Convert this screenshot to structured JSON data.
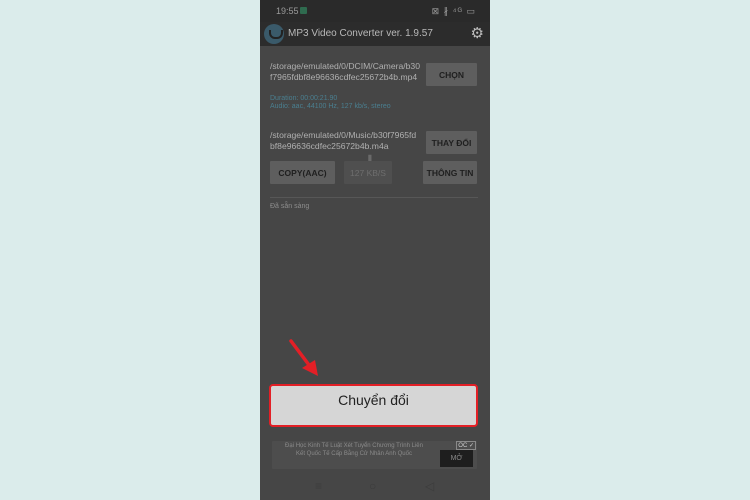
{
  "status_bar": {
    "time": "19:55",
    "right_icons": "⊠ ∦ ⁴ᴳ ▭"
  },
  "app": {
    "title": "MP3 Video Converter ver. 1.9.57"
  },
  "input": {
    "path": "/storage/emulated/0/DCIM/Camera/b30f7965fdbf8e96636cdfec25672b4b.mp4",
    "duration": "Duration: 00:00:21.90",
    "audio": "Audio: aac, 44100 Hz, 127 kb/s, stereo",
    "choose_label": "CHỌN"
  },
  "output": {
    "path": "/storage/emulated/0/Music/b30f7965fdbf8e96636cdfec25672b4b.m4a",
    "change_label": "THAY ĐỔI"
  },
  "options": {
    "codec_label": "COPY(AAC)",
    "bitrate_label": "127 KB/S",
    "info_label": "THÔNG TIN"
  },
  "status": "Đã sẵn sàng",
  "convert_label": "Chuyển đổi",
  "ad": {
    "text": "Đại Học Kinh Tế Luật Xét Tuyển Chương Trình Liên Kết Quốc Tế Cấp Bằng Cử Nhân Anh Quốc",
    "close": "OC ✓",
    "button": "MỞ"
  },
  "nav": {
    "menu": "≡",
    "home": "○",
    "back": "◁"
  }
}
